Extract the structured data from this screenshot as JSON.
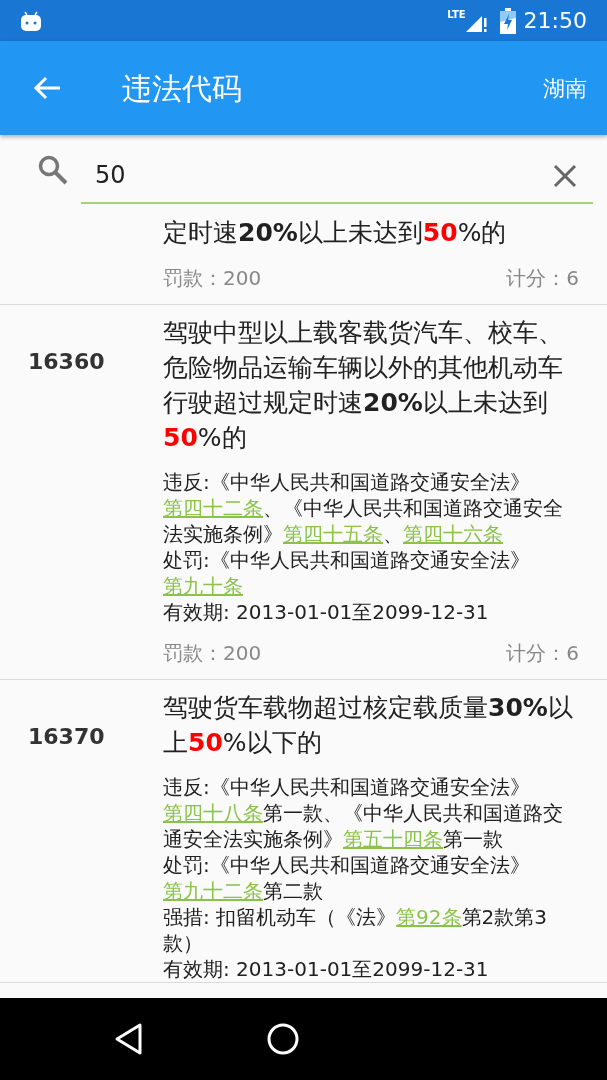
{
  "status_bar": {
    "time": "21:50",
    "network": "LTE"
  },
  "app_bar": {
    "title": "违法代码",
    "region": "湖南"
  },
  "search": {
    "value": "50"
  },
  "items": [
    {
      "description": [
        {
          "kind": "text",
          "text": "定时速"
        },
        {
          "kind": "bold",
          "text": "20%"
        },
        {
          "kind": "text",
          "text": "以上未达到"
        },
        {
          "kind": "highlight",
          "text": "50"
        },
        {
          "kind": "text",
          "text": "%的"
        }
      ],
      "fine": "罚款：200",
      "points": "计分：6"
    },
    {
      "code": "16360",
      "description": [
        {
          "kind": "text",
          "text": "驾驶中型以上载客载货汽车、校车、危险物品运输车辆以外的其他机动车行驶超过规定时速"
        },
        {
          "kind": "bold",
          "text": "20%"
        },
        {
          "kind": "text",
          "text": "以上未达到"
        },
        {
          "kind": "highlight",
          "text": "50"
        },
        {
          "kind": "text",
          "text": "%的"
        }
      ],
      "details": [
        [
          {
            "kind": "text",
            "text": "违反:《中华人民共和国道路交通安全法》"
          },
          {
            "kind": "link",
            "text": "第四十二条"
          },
          {
            "kind": "text",
            "text": "、《中华人民共和国道路交通安全法实施条例》"
          },
          {
            "kind": "link",
            "text": "第四十五条"
          },
          {
            "kind": "text",
            "text": "、"
          },
          {
            "kind": "link",
            "text": "第四十六条"
          }
        ],
        [
          {
            "kind": "text",
            "text": "处罚:《中华人民共和国道路交通安全法》"
          },
          {
            "kind": "link",
            "text": "第九十条"
          }
        ],
        [
          {
            "kind": "text",
            "text": "有效期: 2013-01-01至2099-12-31"
          }
        ]
      ],
      "fine": "罚款：200",
      "points": "计分：6"
    },
    {
      "code": "16370",
      "description": [
        {
          "kind": "text",
          "text": "驾驶货车载物超过核定载质量"
        },
        {
          "kind": "bold",
          "text": "30%"
        },
        {
          "kind": "text",
          "text": "以上"
        },
        {
          "kind": "highlight",
          "text": "50"
        },
        {
          "kind": "text",
          "text": "%以下的"
        }
      ],
      "details": [
        [
          {
            "kind": "text",
            "text": "违反:《中华人民共和国道路交通安全法》"
          },
          {
            "kind": "link",
            "text": "第四十八条"
          },
          {
            "kind": "text",
            "text": "第一款、《中华人民共和国道路交通安全法实施条例》"
          },
          {
            "kind": "link",
            "text": "第五十四条"
          },
          {
            "kind": "text",
            "text": "第一款"
          }
        ],
        [
          {
            "kind": "text",
            "text": "处罚:《中华人民共和国道路交通安全法》"
          },
          {
            "kind": "link",
            "text": "第九十二条"
          },
          {
            "kind": "text",
            "text": "第二款"
          }
        ],
        [
          {
            "kind": "text",
            "text": "强措: 扣留机动车（《法》"
          },
          {
            "kind": "link",
            "text": "第92条"
          },
          {
            "kind": "text",
            "text": "第2款第3款）"
          }
        ],
        [
          {
            "kind": "text",
            "text": "有效期: 2013-01-01至2099-12-31"
          }
        ]
      ]
    }
  ]
}
